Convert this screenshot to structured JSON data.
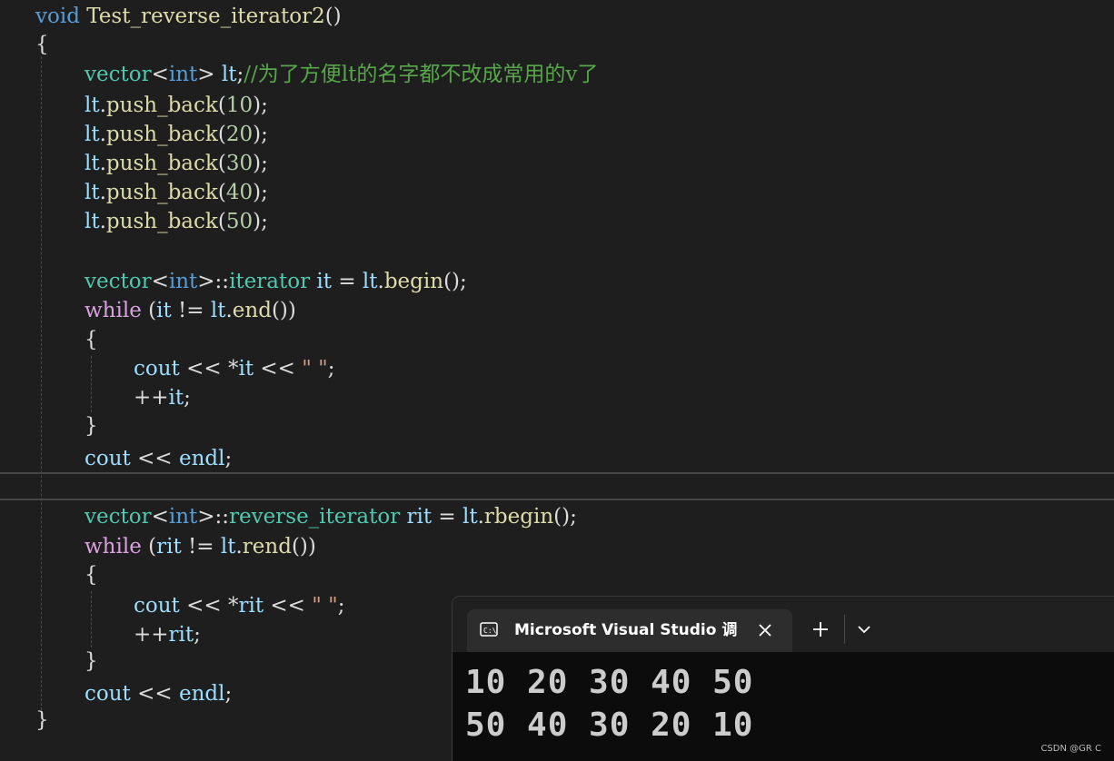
{
  "code": {
    "function_keyword": "void",
    "function_name": "Test_reverse_iterator2",
    "lines": [
      "void Test_reverse_iterator2()",
      "{",
      "vector<int> lt;//为了方便lt的名字都不改成常用的v了",
      "lt.push_back(10);",
      "lt.push_back(20);",
      "lt.push_back(30);",
      "lt.push_back(40);",
      "lt.push_back(50);",
      "vector<int>::iterator it = lt.begin();",
      "while (it != lt.end())",
      "{",
      "cout << *it << \" \";",
      "++it;",
      "}",
      "cout << endl;",
      "vector<int>::reverse_iterator rit = lt.rbegin();",
      "while (rit != lt.rend())",
      "{",
      "cout << *rit << \" \";",
      "++rit;",
      "}",
      "cout << endl;",
      "}"
    ],
    "comment_text": "//为了方便lt的名字都不改成常用的v了"
  },
  "terminal": {
    "tab_title": "Microsoft Visual Studio 调试控制台",
    "output_lines": [
      "10 20 30 40 50",
      "50 40 30 20 10"
    ]
  },
  "icons": {
    "tab_icon": "console-icon",
    "close": "close-icon",
    "new_tab": "plus-icon",
    "dropdown": "chevron-down-icon"
  },
  "colors": {
    "editor_bg": "#1e1e1e",
    "keyword": "#569cd6",
    "control_keyword": "#d8a0df",
    "type": "#4ec9b0",
    "variable": "#9cdcfe",
    "function": "#dcdcaa",
    "number": "#b5cea8",
    "comment": "#57a64a",
    "terminal_bg": "#0c0c0c"
  },
  "watermark": "CSDN @GR C"
}
